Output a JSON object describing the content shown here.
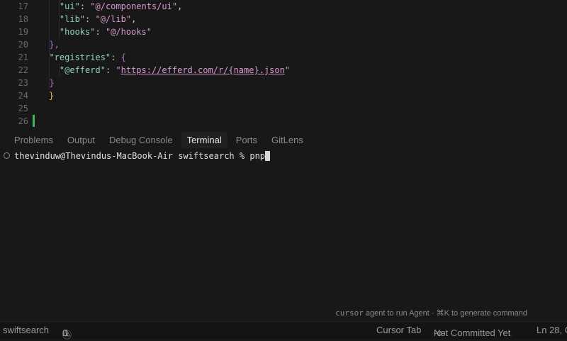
{
  "editor": {
    "lines": [
      {
        "n": "17",
        "indent": "    ",
        "key": "\"ui\"",
        "val": "\"@/components/ui\"",
        "tail": ","
      },
      {
        "n": "18",
        "indent": "    ",
        "key": "\"lib\"",
        "val": "\"@/lib\"",
        "tail": ","
      },
      {
        "n": "19",
        "indent": "    ",
        "key": "\"hooks\"",
        "val": "\"@/hooks\"",
        "tail": ""
      },
      {
        "n": "20",
        "indent": "  ",
        "text": "},"
      },
      {
        "n": "21",
        "indent": "  ",
        "key": "\"registries\"",
        "text": "{"
      },
      {
        "n": "22",
        "indent": "    ",
        "key": "\"@efferd\"",
        "url": "https://efferd.com/r/{name}.json"
      },
      {
        "n": "23",
        "indent": "  ",
        "text": "}"
      },
      {
        "n": "24",
        "indent": "",
        "text": "}"
      },
      {
        "n": "25"
      },
      {
        "n": "26"
      }
    ]
  },
  "panel": {
    "tabs": [
      "Problems",
      "Output",
      "Debug Console",
      "Terminal",
      "Ports",
      "GitLens"
    ],
    "active_tab": "Terminal",
    "prompt": "thevinduw@Thevindus-MacBook-Air swiftsearch % ",
    "input": "pnp",
    "hint_cmd": "cursor",
    "hint_text": " agent to run Agent · ⌘K to generate command"
  },
  "status": {
    "folder": "swiftsearch",
    "errors": "0",
    "warnings": "0",
    "cursor_tab": "Cursor Tab",
    "git": "Not Committed Yet",
    "position": "Ln 28, C"
  }
}
